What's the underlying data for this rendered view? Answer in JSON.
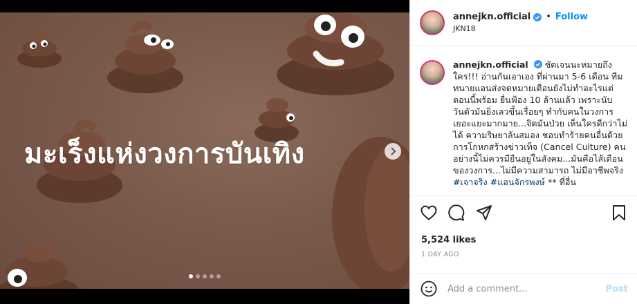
{
  "post": {
    "username": "annejkn.official",
    "follow_label": "Follow",
    "separator": "•",
    "location": "JKN18",
    "media_caption": "มะเร็งแห่งวงการบันเทิง",
    "caption_text": "ชัดเจนนะหมายถึงใคร!!! อ่านกันเอาเอง ที่ผ่านมา 5-6 เดือน ทีมทนายแอนส่งจดหมายเตือนยังไม่ทำอะไรแต่ตอนนี้พร้อม ยื่นฟ้อง 10 ล้านแล้ว เพราะนับวันตัวมันยิ่งเลวขึ้นเรื่อยๆ ทำกับคนในวงการเยอะแยะมากมาย...จิตมันป่วย เห็นใครดีกว่าไม่ได้ ความริษยาล้นสมอง ชอบทำร้ายคนอื่นด้วยการโกหกสร้างข่าวเท็จ (Cancel Culture) คนอย่างนี้ไม่ควรมียืนอยู่ในสังคม...มันคือไส้เดือนของวงการ...ไม่มีความสามารถ ไม่มีอาชีพจริง",
    "caption_hashtags": "#เจาจริง #แอนจักรพงษ์",
    "caption_tail": " ** ที่อื่น",
    "likes": "5,524 likes",
    "time_ago": "1 DAY AGO",
    "comment_placeholder": "Add a comment...",
    "post_label": "Post",
    "carousel": {
      "count": 5,
      "active_index": 0
    }
  },
  "icons": {
    "verified": "verified-badge-icon",
    "like": "heart-icon",
    "comment": "comment-bubble-icon",
    "share": "paper-plane-icon",
    "save": "bookmark-icon",
    "emoji": "smiley-icon",
    "next": "chevron-right-icon"
  },
  "colors": {
    "accent": "#0095f6",
    "media_bg": "#7a5a4b",
    "verified": "#3897f0"
  }
}
